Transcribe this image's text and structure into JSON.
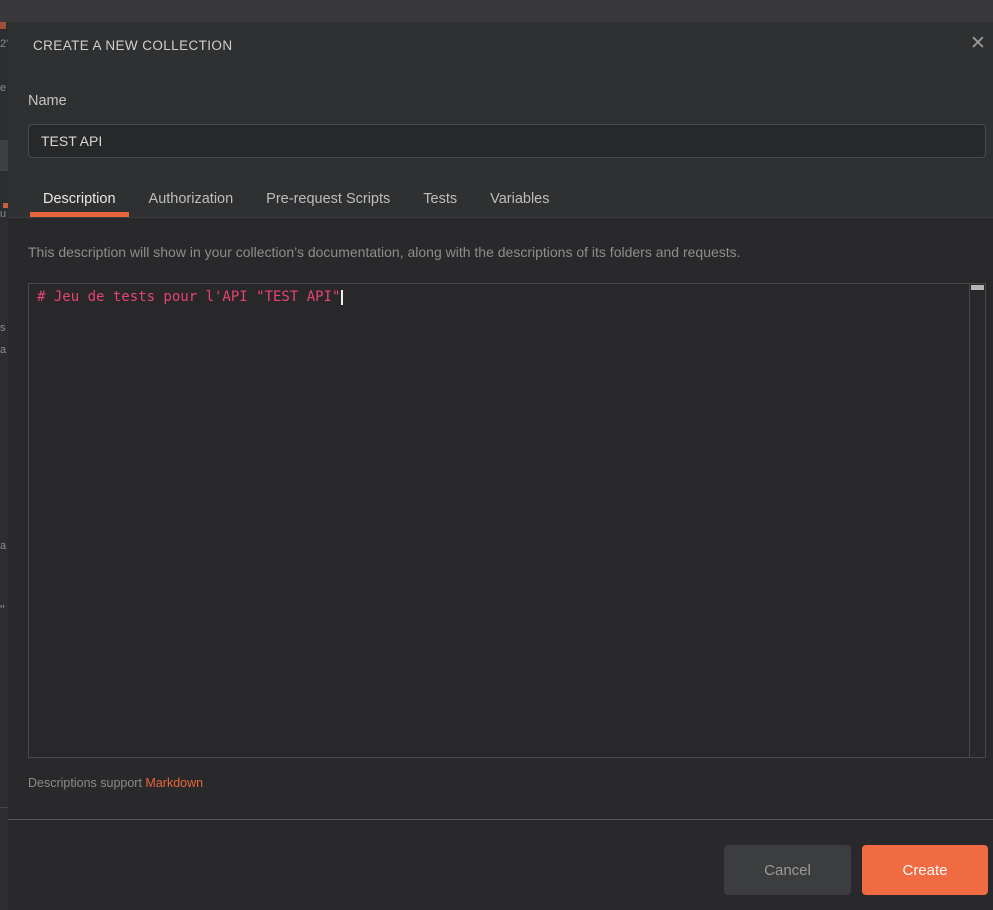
{
  "app_background": {
    "fragments": [
      "2'",
      "e",
      "u",
      "s",
      "a",
      "a",
      "\""
    ]
  },
  "dialog": {
    "title": "CREATE A NEW COLLECTION",
    "close_icon": "✕",
    "name": {
      "label": "Name",
      "value": "TEST API"
    },
    "tabs": [
      {
        "label": "Description",
        "active": true
      },
      {
        "label": "Authorization",
        "active": false
      },
      {
        "label": "Pre-request Scripts",
        "active": false
      },
      {
        "label": "Tests",
        "active": false
      },
      {
        "label": "Variables",
        "active": false
      }
    ],
    "description_hint": "This description will show in your collection’s documentation, along with the descriptions of its folders and requests.",
    "editor": {
      "content": "# Jeu de tests pour l'API \"TEST API\""
    },
    "markdown_note": {
      "prefix": "Descriptions support ",
      "link": "Markdown"
    },
    "footer": {
      "cancel_label": "Cancel",
      "create_label": "Create"
    }
  },
  "colors": {
    "accent_orange": "#e8663c",
    "create_button_orange": "#f06b42",
    "code_pink": "#e8446f",
    "dialog_header_bg": "#2f3031",
    "dialog_body_bg": "#29292b"
  }
}
